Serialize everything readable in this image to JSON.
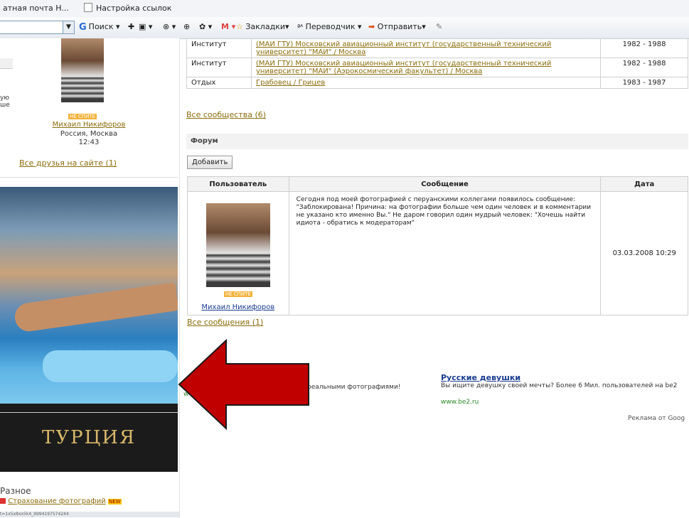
{
  "browser": {
    "bookmarks": [
      "атная почта H...",
      "Настройка ссылок"
    ],
    "toolbar": {
      "search_label": "Поиск",
      "bookmarks_label": "Закладки",
      "translator_label": "Переводчик",
      "send_label": "Отправить"
    }
  },
  "sidebar": {
    "fragment1": "ую",
    "fragment2": "ше",
    "profile": {
      "badge": "НЕ СПИТЕ",
      "name": "Михаил Никифоров",
      "location": "Россия, Москва",
      "time": "12:43"
    },
    "friends_link": "Все друзья на сайте (1)",
    "ad_title": "ТУРЦИЯ",
    "misc_heading": "Разное",
    "misc_link": "Страхование фотографий",
    "misc_new_badge": "NEW",
    "status_fragment": "t=1x5x8xx5k4_9994197574244"
  },
  "communities": {
    "rows": [
      {
        "type": "Институт",
        "name": "(МАИ ГТУ) Московский авиационный институт (государственный технический университет) \"МАИ\" / Москва",
        "years": "1982 - 1988"
      },
      {
        "type": "Институт",
        "name": "(МАИ ГТУ) Московский авиационный институт (государственный технический университет) \"МАИ\" (Аэрокосмический факультет) / Москва",
        "years": "1982 - 1988"
      },
      {
        "type": "Отдых",
        "name": "Грабовец / Грицев",
        "years": "1983 - 1987"
      }
    ],
    "all_link": "Все сообщества (6)"
  },
  "forum": {
    "heading": "Форум",
    "add_button": "Добавить",
    "columns": [
      "Пользователь",
      "Сообщение",
      "Дата"
    ],
    "post": {
      "badge": "НЕ СПИТЕ",
      "author": "Михаил Никифоров",
      "message": "Сегодня под моей фотографией с перуанскими коллегами появилось сообщение: \"Заблокирована! Причина: на фотографии больше чем один человек и в комментарии не указано кто именно Вы.\" Не даром говорил один мудрый человек: \"Хочешь найти идиота - обратись к модераторам\"",
      "date": "03.03.2008 10:29"
    },
    "all_link": "Все сообщения (1)"
  },
  "ads": {
    "left_fragment": "реальными фотографиями!",
    "left_url_fragment": "w",
    "title": "Русские девушки",
    "text": "Вы ищите девушку своей мечты? Более 6 Мил. пользователей на be2",
    "url": "www.be2.ru",
    "footer": "Реклама от Goog"
  },
  "colors": {
    "arrow_fill": "#c00000",
    "link_orange": "#8a6d0c",
    "link_blue": "#1a3c8f",
    "url_green": "#2a8a2a"
  }
}
